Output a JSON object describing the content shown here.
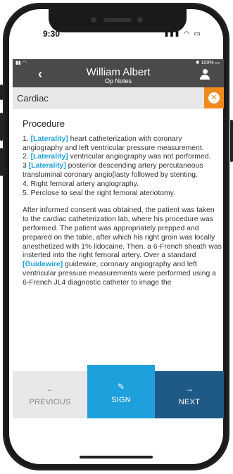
{
  "device": {
    "time": "9:30",
    "status_icons": "▮▮▮ ◠ ▭"
  },
  "app_status": {
    "left": "▮▮ ◠",
    "right": "✱ 100% ▭"
  },
  "header": {
    "back_icon": "‹",
    "patient_name": "William Albert",
    "subtitle": "Op Notes"
  },
  "category": {
    "label": "Cardiac",
    "close_icon": "✕"
  },
  "section": {
    "title": "Procedure"
  },
  "tags": {
    "laterality": "[Laterality]",
    "guidewire": "[Guidewire]"
  },
  "procedures": {
    "p1_num": "1. ",
    "p1_text": " heart catheterization with coronary angiography and left ventricular pressure measurement.",
    "p2_num": "2. ",
    "p2_text": " ventricular angiography was not performed.",
    "p3_num": "3 ",
    "p3_text": " posterior descending artery percutaneous transluminal coronary angio[lasty followed by stenting.",
    "p4": "4. Right femoral artery angiography.",
    "p5": "5. Perclose to seal the right femoral ateriotomy."
  },
  "narrative": {
    "before": "After informed consent was obtained, the patient was taken to the cardiac catheterization lab, where his procedure was performed. The patient was appropriately prepped and prepared on the table, after which his right groin was locally anesthetized with 1% lidocaine. Then, a 6-French sheath was insterted into the right femoral artery. Over a standard ",
    "after": " guidewire, coronary angiography and left ventricular pressure measurements were performed using a 6-French JL4 diagnostic catheter to image the"
  },
  "bottom": {
    "previous": {
      "icon": "←",
      "label": "PREVIOUS"
    },
    "sign": {
      "icon": "✎",
      "label": "SIGN"
    },
    "next": {
      "icon": "→",
      "label": "NEXT"
    }
  }
}
